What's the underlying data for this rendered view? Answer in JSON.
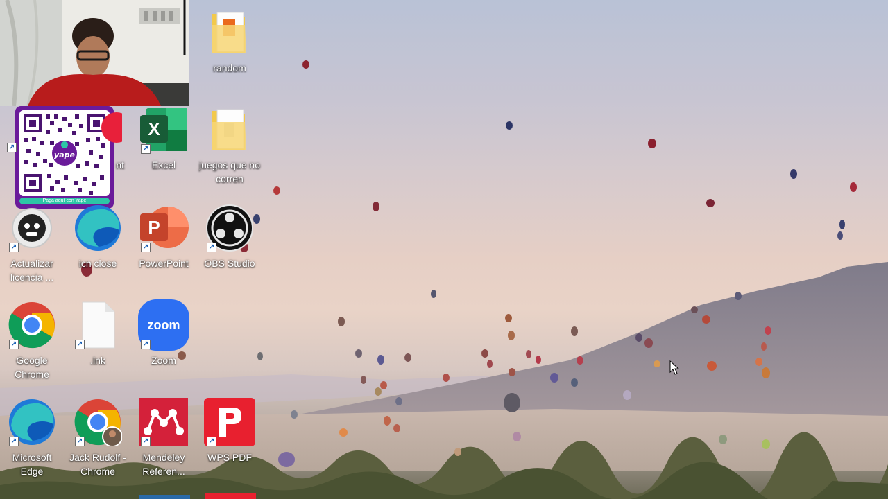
{
  "desktop": {
    "icons": [
      {
        "id": "random",
        "label": "random"
      },
      {
        "id": "excel",
        "label": "Excel"
      },
      {
        "id": "juegos",
        "label": "juegos que no corren"
      },
      {
        "id": "hidden-acrobat",
        "label": "nt"
      },
      {
        "id": "actualizar",
        "label": "Actualizar licencia ..."
      },
      {
        "id": "icn-close",
        "label": "icn close"
      },
      {
        "id": "powerpoint",
        "label": "PowerPoint"
      },
      {
        "id": "obs",
        "label": "OBS Studio"
      },
      {
        "id": "chrome",
        "label": "Google Chrome"
      },
      {
        "id": "lnk",
        "label": ".lnk"
      },
      {
        "id": "zoom",
        "label": "Zoom"
      },
      {
        "id": "edge",
        "label": "Microsoft Edge"
      },
      {
        "id": "jack-chrome",
        "label": "Jack Rudolf - Chrome"
      },
      {
        "id": "mendeley",
        "label": "Mendeley Referen..."
      },
      {
        "id": "wps",
        "label": "WPS PDF"
      }
    ]
  },
  "overlay": {
    "qr_caption": "Paga aquí con Yape",
    "qr_brand": "yape"
  },
  "icon_glyphs": {
    "excel": "X",
    "powerpoint": "P",
    "zoom": "zoom"
  },
  "colors": {
    "excel": "#1d7044",
    "powerpoint": "#c4432b",
    "zoom": "#2d6ff2",
    "mendeley": "#d4213a",
    "wps": "#e8202f",
    "yape": "#6a1b9a"
  }
}
